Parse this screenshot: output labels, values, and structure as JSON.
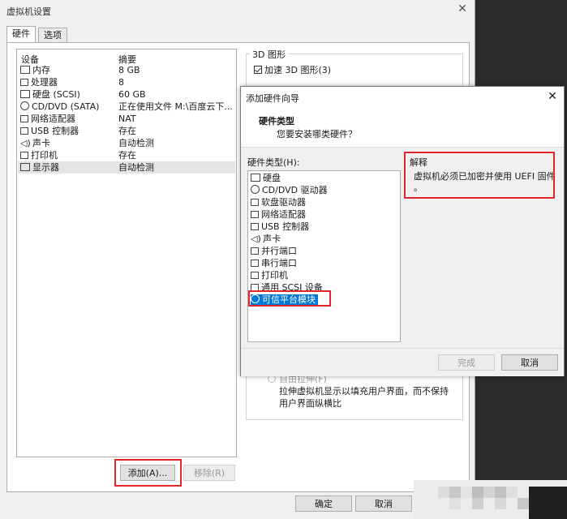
{
  "main_window": {
    "title": "虚拟机设置",
    "close_glyph": "✕",
    "tabs": [
      {
        "label": "硬件"
      },
      {
        "label": "选项"
      }
    ],
    "device_list": {
      "col_device": "设备",
      "col_summary": "摘要",
      "rows": [
        {
          "name": "内存",
          "summary": "8 GB",
          "icon": "memory-icon"
        },
        {
          "name": "处理器",
          "summary": "8",
          "icon": "processor-icon"
        },
        {
          "name": "硬盘 (SCSI)",
          "summary": "60 GB",
          "icon": "hard-disk-icon"
        },
        {
          "name": "CD/DVD (SATA)",
          "summary": "正在使用文件 M:\\百度云下...",
          "icon": "cd-dvd-icon"
        },
        {
          "name": "网络适配器",
          "summary": "NAT",
          "icon": "network-adapter-icon"
        },
        {
          "name": "USB 控制器",
          "summary": "存在",
          "icon": "usb-icon"
        },
        {
          "name": "声卡",
          "summary": "自动检测",
          "icon": "sound-card-icon"
        },
        {
          "name": "打印机",
          "summary": "存在",
          "icon": "printer-icon"
        },
        {
          "name": "显示器",
          "summary": "自动检测",
          "icon": "display-icon",
          "selected": true
        }
      ]
    },
    "add_button": "添加(A)...",
    "remove_button": "移除(R)",
    "graphics_group": {
      "title": "3D 图形",
      "accelerate_checkbox": "加速 3D 图形(3)",
      "accelerate_checked": true
    },
    "stretch": {
      "radio_label": "自由拉伸(F)",
      "description": "拉伸虚拟机显示以填充用户界面，而不保持用户界面纵横比"
    },
    "ok_button": "确定",
    "cancel_button": "取消"
  },
  "wizard": {
    "title": "添加硬件向导",
    "close_glyph": "✕",
    "header_title": "硬件类型",
    "header_subtitle": "您要安装哪类硬件？",
    "list_label": "硬件类型(H):",
    "items": [
      {
        "label": "硬盘",
        "icon": "hard-disk-icon"
      },
      {
        "label": "CD/DVD 驱动器",
        "icon": "cd-dvd-icon"
      },
      {
        "label": "软盘驱动器",
        "icon": "floppy-icon"
      },
      {
        "label": "网络适配器",
        "icon": "network-adapter-icon"
      },
      {
        "label": "USB 控制器",
        "icon": "usb-icon"
      },
      {
        "label": "声卡",
        "icon": "sound-card-icon"
      },
      {
        "label": "并行端口",
        "icon": "parallel-port-icon"
      },
      {
        "label": "串行端口",
        "icon": "serial-port-icon"
      },
      {
        "label": "打印机",
        "icon": "printer-icon"
      },
      {
        "label": "通用 SCSI 设备",
        "icon": "scsi-icon"
      },
      {
        "label": "可信平台模块",
        "icon": "tpm-icon",
        "selected": true
      }
    ],
    "explanation_title": "解释",
    "explanation_text": "虚拟机必须已加密并使用 UEFI 固件",
    "explanation_period": "。",
    "finish_button": "完成",
    "cancel_button": "取消"
  },
  "colors": {
    "highlight_red": "#e0262b",
    "selection_blue": "#0078d7"
  }
}
